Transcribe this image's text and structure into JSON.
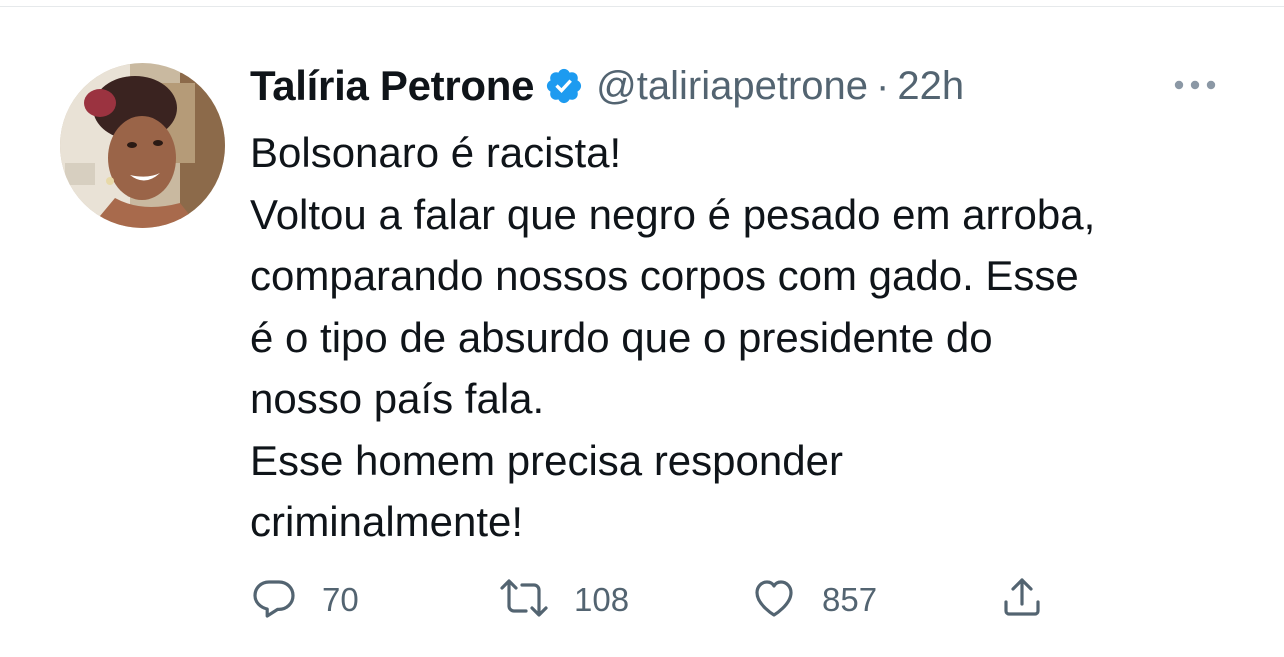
{
  "author": {
    "display_name": "Talíria Petrone",
    "handle": "@taliriapetrone",
    "separator": "·",
    "time": "22h",
    "verified": true,
    "avatar_icon": "profile-photo"
  },
  "tweet": {
    "lines": [
      "Bolsonaro é racista!",
      "Voltou a falar que negro é pesado em arroba,",
      "comparando nossos corpos com gado. Esse",
      "é o tipo de absurdo que o presidente do",
      "nosso país fala.",
      "Esse homem precisa responder",
      "criminalmente!"
    ]
  },
  "actions": {
    "reply": {
      "icon": "reply-icon",
      "count": "70"
    },
    "retweet": {
      "icon": "retweet-icon",
      "count": "108"
    },
    "like": {
      "icon": "heart-icon",
      "count": "857"
    },
    "share": {
      "icon": "share-icon"
    }
  },
  "colors": {
    "text": "#0f1419",
    "secondary": "#536471",
    "verified_badge": "#1d9bf0",
    "background": "#ffffff"
  }
}
